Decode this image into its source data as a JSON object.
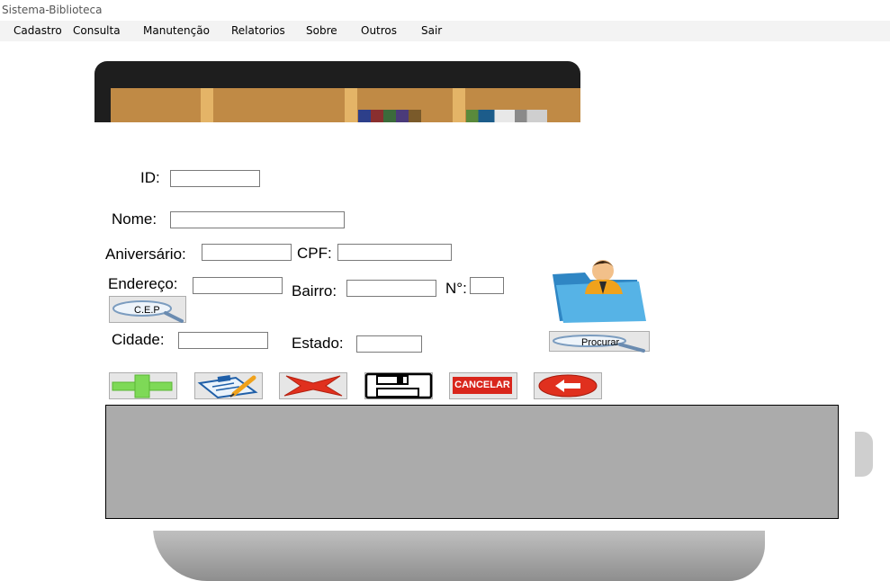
{
  "window": {
    "title": "Sistema-Biblioteca"
  },
  "menu": {
    "items": [
      {
        "label": "Cadastro"
      },
      {
        "label": "Consulta"
      },
      {
        "label": "Manutenção"
      },
      {
        "label": "Relatorios"
      },
      {
        "label": "Sobre"
      },
      {
        "label": "Outros"
      },
      {
        "label": "Sair"
      }
    ]
  },
  "form": {
    "id_label": "ID:",
    "id_value": "",
    "nome_label": "Nome:",
    "nome_value": "",
    "aniversario_label": "Aniversário:",
    "aniversario_value": "",
    "cpf_label": "CPF:",
    "cpf_value": "",
    "endereco_label": "Endereço:",
    "endereco_value": "",
    "bairro_label": "Bairro:",
    "bairro_value": "",
    "numero_label": "N°:",
    "numero_value": "",
    "cep_button": "C.E.P",
    "cidade_label": "Cidade:",
    "cidade_value": "",
    "estado_label": "Estado:",
    "estado_value": "",
    "procurar_button": "Procurar"
  },
  "toolbar": {
    "add_icon": "plus-icon",
    "edit_icon": "clipboard-edit-icon",
    "delete_icon": "x-icon",
    "save_icon": "floppy-disk-icon",
    "cancel_label": "CANCELAR",
    "back_icon": "back-arrow-icon"
  },
  "colors": {
    "menubar": "#f3f3f3",
    "grid": "#ababab",
    "plus_green": "#7ed957",
    "delete_red": "#e0301e",
    "cancel_red": "#d9261c",
    "folder_blue": "#3f9fd8"
  }
}
